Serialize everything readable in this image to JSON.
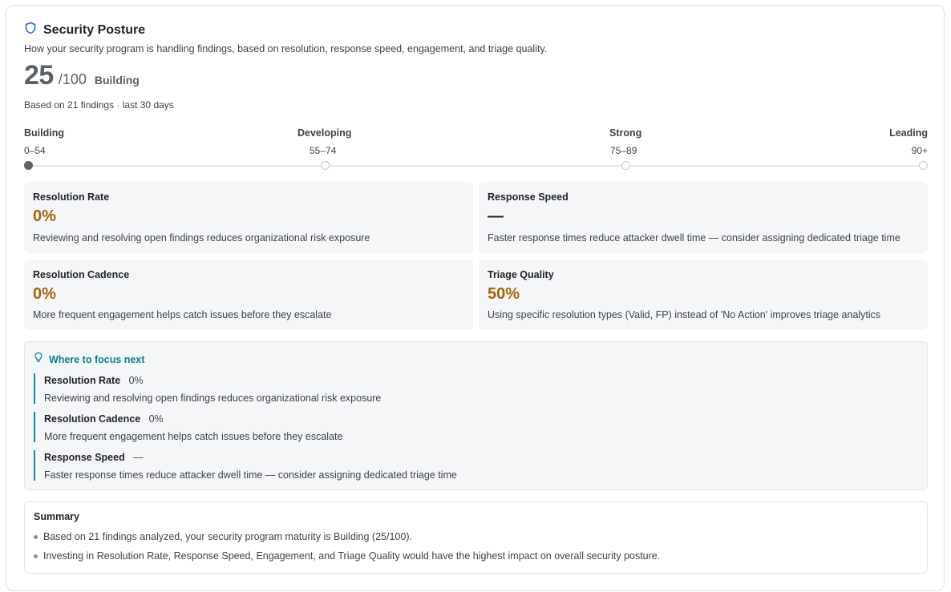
{
  "header": {
    "icon": "shield-icon",
    "title": "Security Posture",
    "subtitle": "How your security program is handling findings, based on resolution, response speed, engagement, and triage quality."
  },
  "score": {
    "value": "25",
    "denominator": "/100",
    "level": "Building",
    "basis": "Based on 21 findings · last 30 days"
  },
  "scale": {
    "levels": [
      {
        "label": "Building",
        "range": "0–54",
        "active": true
      },
      {
        "label": "Developing",
        "range": "55–74",
        "active": false
      },
      {
        "label": "Strong",
        "range": "75–89",
        "active": false
      },
      {
        "label": "Leading",
        "range": "90+",
        "active": false
      }
    ]
  },
  "metrics": [
    {
      "name": "Resolution Rate",
      "value": "0%",
      "description": "Reviewing and resolving open findings reduces organizational risk exposure"
    },
    {
      "name": "Response Speed",
      "value": "—",
      "description": "Faster response times reduce attacker dwell time — consider assigning dedicated triage time"
    },
    {
      "name": "Resolution Cadence",
      "value": "0%",
      "description": "More frequent engagement helps catch issues before they escalate"
    },
    {
      "name": "Triage Quality",
      "value": "50%",
      "description": "Using specific resolution types (Valid, FP) instead of 'No Action' improves triage analytics"
    }
  ],
  "focus": {
    "icon": "lightbulb-icon",
    "title": "Where to focus next",
    "items": [
      {
        "name": "Resolution Rate",
        "value": "0%",
        "description": "Reviewing and resolving open findings reduces organizational risk exposure"
      },
      {
        "name": "Resolution Cadence",
        "value": "0%",
        "description": "More frequent engagement helps catch issues before they escalate"
      },
      {
        "name": "Response Speed",
        "value": "—",
        "description": "Faster response times reduce attacker dwell time — consider assigning dedicated triage time"
      }
    ]
  },
  "summary": {
    "title": "Summary",
    "items": [
      "Based on 21 findings analyzed, your security program maturity is Building (25/100).",
      "Investing in Resolution Rate, Response Speed, Engagement, and Triage Quality would have the highest impact on overall security posture."
    ]
  },
  "colors": {
    "accent_value": "#a4640a",
    "focus_accent": "#0b7d8f",
    "shield": "#1a66d2"
  }
}
